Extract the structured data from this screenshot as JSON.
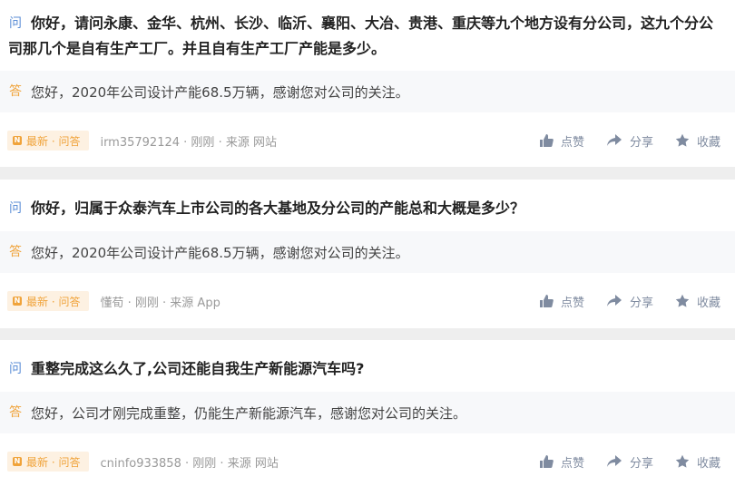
{
  "labels": {
    "question_tag": "问",
    "answer_tag": "答",
    "badge_icon": "N",
    "like": "点赞",
    "share": "分享",
    "favorite": "收藏"
  },
  "colors": {
    "question_tag": "#5b8ed6",
    "answer_tag": "#f0a33a",
    "action": "#7f8ba0"
  },
  "icons": [
    "thumb-up-icon",
    "share-arrow-icon",
    "star-icon"
  ],
  "items": [
    {
      "question_line1": "你好，请问永康、金华、杭州、长沙、临沂、襄阳、大冶、贵港、重庆等九个地方设有分公司，这九个分公",
      "question_line2": "司那几个是自有生产工厂。并且自有生产工厂产能是多少。",
      "answer": "您好，2020年公司设计产能68.5万辆，感谢您对公司的关注。",
      "badge": "最新 · 问答",
      "user": "irm35792124",
      "time": "刚刚",
      "source": "来源 网站"
    },
    {
      "question_line1": "你好，归属于众泰汽车上市公司的各大基地及分公司的产能总和大概是多少？",
      "answer": "您好，2020年公司设计产能68.5万辆，感谢您对公司的关注。",
      "badge": "最新 · 问答",
      "user": "懂荀",
      "time": "刚刚",
      "source": "来源 App"
    },
    {
      "question_line1": "重整完成这么久了,公司还能自我生产新能源汽车吗?",
      "answer": "您好，公司才刚完成重整，仍能生产新能源汽车，感谢您对公司的关注。",
      "badge": "最新 · 问答",
      "user": "cninfo933858",
      "time": "刚刚",
      "source": "来源 网站"
    }
  ]
}
